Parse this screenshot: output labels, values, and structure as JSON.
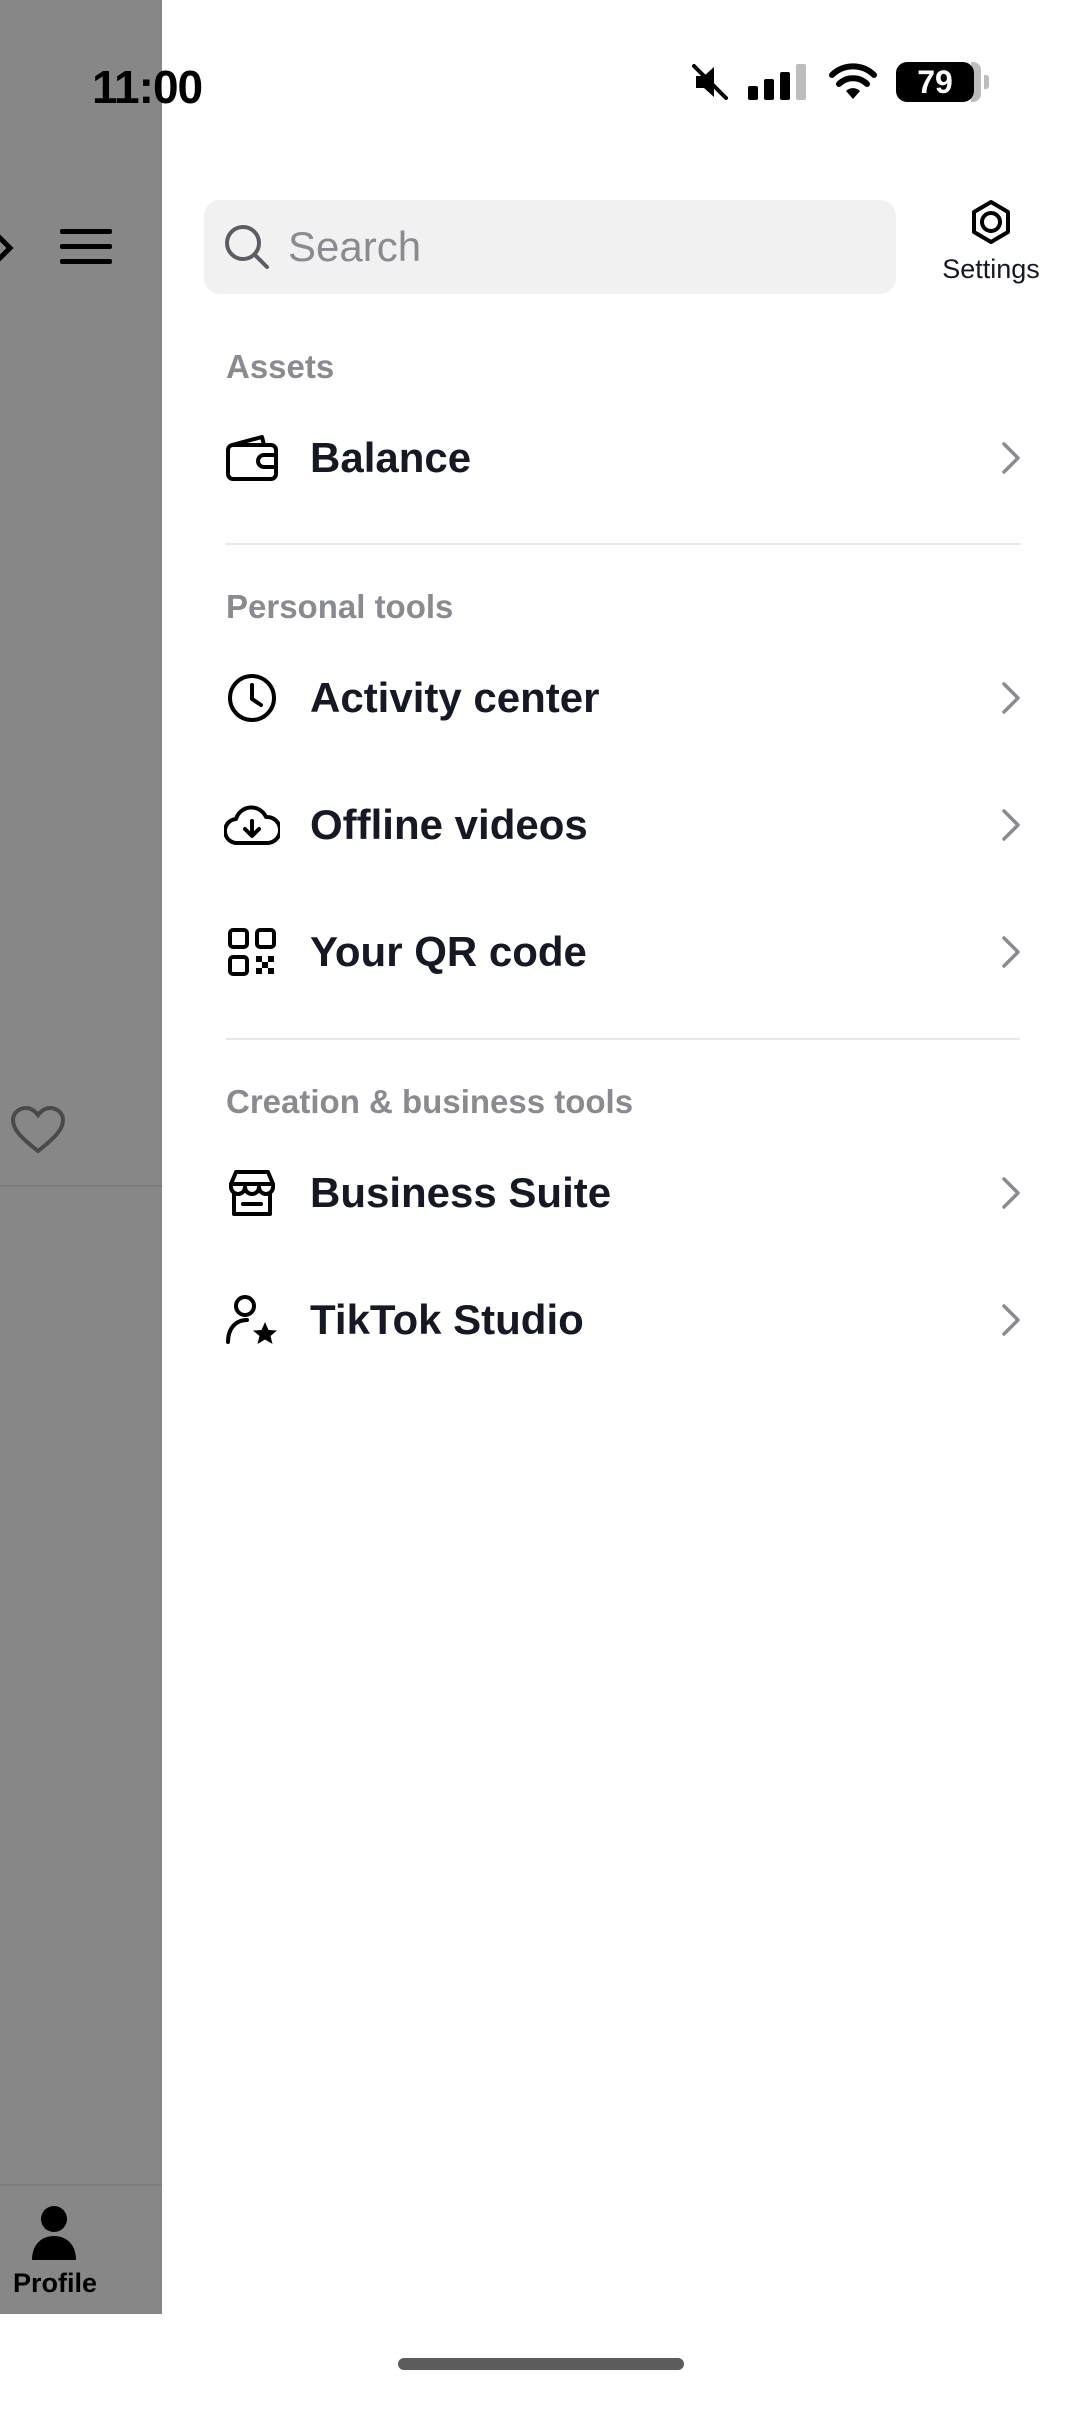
{
  "status_bar": {
    "time": "11:00",
    "battery": "79"
  },
  "background_app": {
    "tab_profile_label": "Profile"
  },
  "drawer": {
    "search": {
      "placeholder": "Search",
      "value": ""
    },
    "settings_label": "Settings",
    "sections": [
      {
        "label": "Assets",
        "items": [
          {
            "label": "Balance",
            "icon": "wallet-icon"
          }
        ]
      },
      {
        "label": "Personal tools",
        "items": [
          {
            "label": "Activity center",
            "icon": "clock-icon"
          },
          {
            "label": "Offline videos",
            "icon": "cloud-download-icon"
          },
          {
            "label": "Your QR code",
            "icon": "qr-code-icon"
          }
        ]
      },
      {
        "label": "Creation & business tools",
        "items": [
          {
            "label": "Business Suite",
            "icon": "store-icon"
          },
          {
            "label": "TikTok Studio",
            "icon": "user-star-icon"
          }
        ]
      }
    ]
  },
  "colors": {
    "label_gray": "#8a8b91",
    "text": "#161823",
    "overlay": "#878787"
  }
}
